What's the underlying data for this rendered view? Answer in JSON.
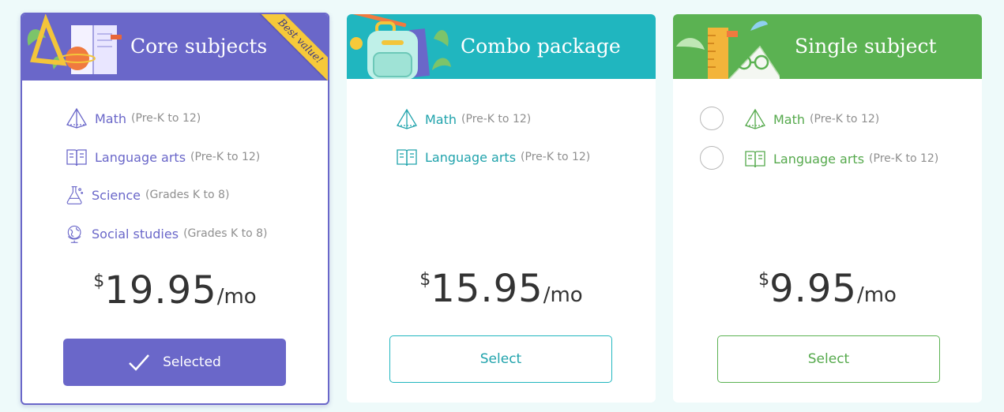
{
  "colors": {
    "core": "#6a67c9",
    "combo": "#20b6bf",
    "single": "#5bb252",
    "ribbon": "#f6c93a",
    "page_bg": "#eefafa"
  },
  "plans": [
    {
      "id": "core",
      "title": "Core subjects",
      "badge": "Best value!",
      "art": "school-supplies-illustration",
      "subjects": [
        {
          "name": "Math",
          "range": "(Pre-K to 12)",
          "icon": "pyramid-icon"
        },
        {
          "name": "Language arts",
          "range": "(Pre-K to 12)",
          "icon": "book-icon"
        },
        {
          "name": "Science",
          "range": "(Grades K to 8)",
          "icon": "flask-icon"
        },
        {
          "name": "Social studies",
          "range": "(Grades K to 8)",
          "icon": "globe-icon"
        }
      ],
      "currency": "$",
      "amount": "19.95",
      "period": "/mo",
      "button": "Selected",
      "button_icon": "checkmark-icon",
      "selected": true
    },
    {
      "id": "combo",
      "title": "Combo package",
      "art": "backpack-illustration",
      "subjects": [
        {
          "name": "Math",
          "range": "(Pre-K to 12)",
          "icon": "pyramid-icon"
        },
        {
          "name": "Language arts",
          "range": "(Pre-K to 12)",
          "icon": "book-icon"
        }
      ],
      "currency": "$",
      "amount": "15.95",
      "period": "/mo",
      "button": "Select",
      "selected": false
    },
    {
      "id": "single",
      "title": "Single subject",
      "art": "ruler-and-glasses-illustration",
      "subjects": [
        {
          "name": "Math",
          "range": "(Pre-K to 12)",
          "icon": "pyramid-icon",
          "radio": true
        },
        {
          "name": "Language arts",
          "range": "(Pre-K to 12)",
          "icon": "book-icon",
          "radio": true
        }
      ],
      "currency": "$",
      "amount": "9.95",
      "period": "/mo",
      "button": "Select",
      "selected": false
    }
  ]
}
